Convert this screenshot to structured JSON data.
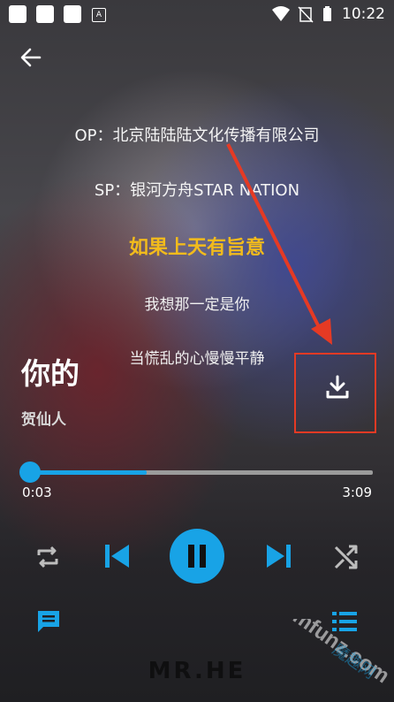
{
  "status_bar": {
    "time": "10:22"
  },
  "credits": {
    "op": "OP：北京陆陆陆文化传播有限公司",
    "sp": "SP：银河方舟STAR NATION"
  },
  "lyrics": {
    "current": "如果上天有旨意",
    "next1": "我想那一定是你",
    "next2": "当慌乱的心慢慢平静"
  },
  "song": {
    "title": "你的",
    "artist": "贺仙人"
  },
  "playback": {
    "current_time": "0:03",
    "duration": "3:09",
    "progress_fraction": 0.34
  },
  "colors": {
    "accent": "#18a3e6",
    "lyric_highlight": "#f2bb1c",
    "annotation_red": "#e53a24"
  },
  "bottom": {
    "logo": "MR.HE"
  },
  "watermark": {
    "text": "mfunz.com",
    "cn": "魔趣网"
  }
}
